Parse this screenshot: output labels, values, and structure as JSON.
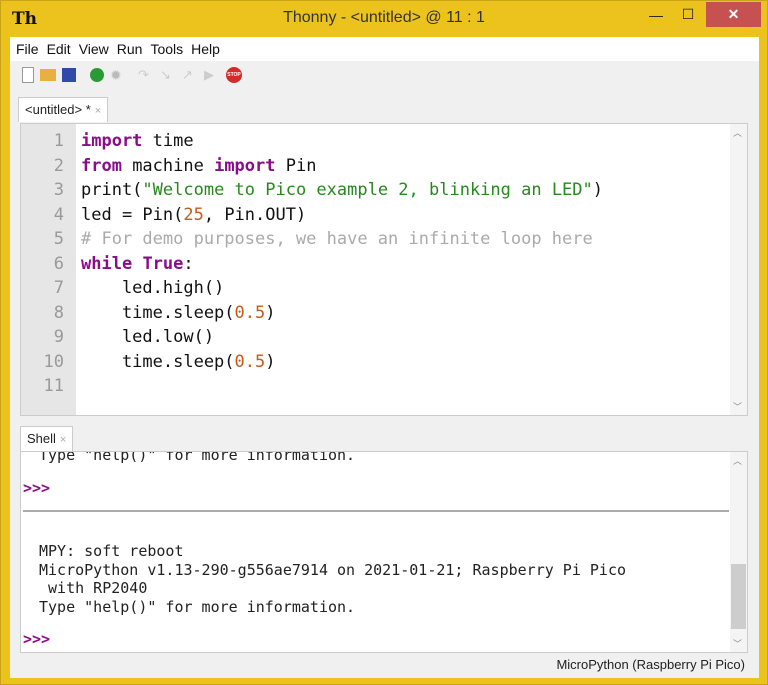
{
  "window": {
    "title": "Thonny  -  <untitled>  @  11 : 1",
    "logo": "Th",
    "minimize": "—",
    "maximize": "☐",
    "close": "✕"
  },
  "menu": [
    "File",
    "Edit",
    "View",
    "Run",
    "Tools",
    "Help"
  ],
  "editor_tab": {
    "label": "<untitled> *",
    "close": "×"
  },
  "shell_tab": {
    "label": "Shell",
    "close": "×"
  },
  "line_numbers": [
    "1",
    "2",
    "3",
    "4",
    "5",
    "6",
    "7",
    "8",
    "9",
    "10",
    "11"
  ],
  "code": {
    "l1": [
      "import",
      " time"
    ],
    "l2": [
      "from",
      " machine ",
      "import",
      " Pin"
    ],
    "l3": [
      "print(",
      "\"Welcome to Pico example 2, blinking an LED\"",
      ")"
    ],
    "l4": [
      "led = Pin(",
      "25",
      ", Pin.OUT)"
    ],
    "l5": "# For demo purposes, we have an infinite loop here",
    "l6": [
      "while",
      " ",
      "True",
      ":"
    ],
    "l7": "    led.high()",
    "l8": [
      "    time.sleep(",
      "0.5",
      ")"
    ],
    "l9": "    led.low()",
    "l10": [
      "    time.sleep(",
      "0.5",
      ")"
    ]
  },
  "shell": {
    "top_line": "Type \"help()\" for more information.",
    "prompt": ">>>",
    "lines": [
      "MPY: soft reboot",
      "MicroPython v1.13-290-g556ae7914 on 2021-01-21; Raspberry Pi Pico",
      " with RP2040",
      "Type \"help()\" for more information."
    ]
  },
  "status": "MicroPython (Raspberry Pi Pico)",
  "toolbar": {
    "stop_label": "STOP"
  }
}
